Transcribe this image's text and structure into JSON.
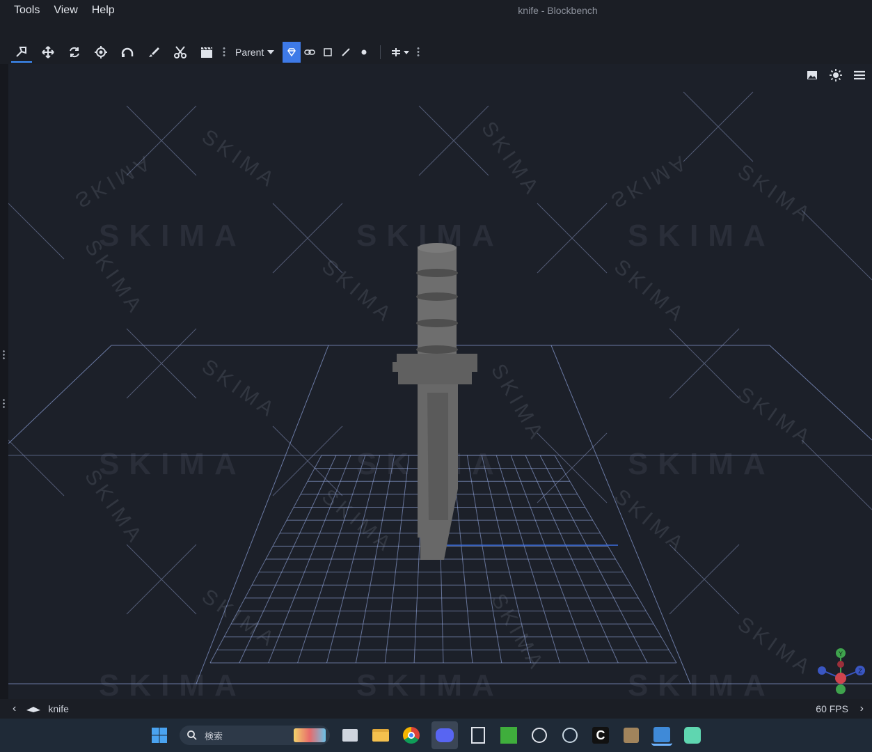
{
  "window": {
    "title": "knife - Blockbench"
  },
  "menu": {
    "items": [
      "Tools",
      "View",
      "Help"
    ]
  },
  "toolbar": {
    "tools": [
      {
        "name": "move-tool-icon"
      },
      {
        "name": "move-arrows-icon"
      },
      {
        "name": "rotate-icon"
      },
      {
        "name": "pivot-icon"
      },
      {
        "name": "vertex-snap-icon"
      },
      {
        "name": "paint-brush-icon"
      },
      {
        "name": "scissors-icon"
      },
      {
        "name": "clapper-icon"
      }
    ],
    "parent_select": "Parent"
  },
  "viewport": {
    "watermark": "SKIMA"
  },
  "statusbar": {
    "project_name": "knife",
    "fps": "60 FPS"
  },
  "taskbar": {
    "search_placeholder": "検索"
  },
  "gizmo": {
    "y": "Y",
    "z": "Z"
  },
  "colors": {
    "accent": "#3e7ae8",
    "background": "#1c2029",
    "panel": "#1b1e25"
  }
}
